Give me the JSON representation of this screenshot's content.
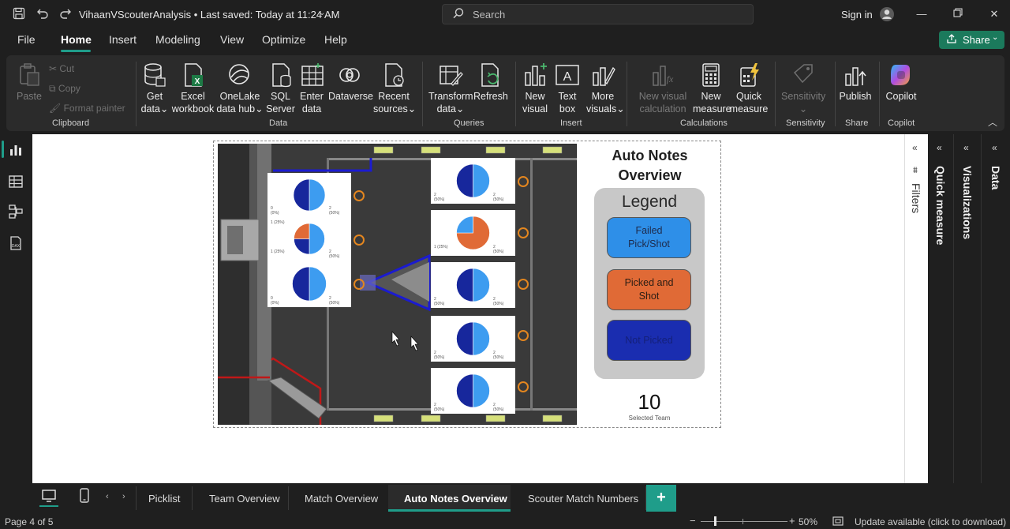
{
  "titlebar": {
    "document_title": "VihaanVScouterAnalysis • Last saved: Today at 11:24 AM",
    "search_placeholder": "Search",
    "sign_in": "Sign in"
  },
  "menu": {
    "items": [
      "File",
      "Home",
      "Insert",
      "Modeling",
      "View",
      "Optimize",
      "Help"
    ],
    "active": "Home",
    "share_label": "Share"
  },
  "ribbon": {
    "clipboard": {
      "paste": "Paste",
      "cut": "Cut",
      "copy": "Copy",
      "format_painter": "Format painter",
      "group": "Clipboard"
    },
    "data": {
      "get_data": [
        "Get",
        "data"
      ],
      "excel": [
        "Excel",
        "workbook"
      ],
      "onelake": [
        "OneLake",
        "data hub"
      ],
      "sql": [
        "SQL",
        "Server"
      ],
      "enter": [
        "Enter",
        "data"
      ],
      "dataverse": "Dataverse",
      "recent": [
        "Recent",
        "sources"
      ],
      "group": "Data"
    },
    "queries": {
      "transform": [
        "Transform",
        "data"
      ],
      "refresh": "Refresh",
      "group": "Queries"
    },
    "insert": {
      "new_visual": [
        "New",
        "visual"
      ],
      "text_box": [
        "Text",
        "box"
      ],
      "more_visuals": [
        "More",
        "visuals"
      ],
      "group": "Insert"
    },
    "calculations": {
      "new_visual_calc": [
        "New visual",
        "calculation"
      ],
      "new_measure": [
        "New",
        "measure"
      ],
      "quick_measure": [
        "Quick",
        "measure"
      ],
      "group": "Calculations"
    },
    "sensitivity": {
      "label": "Sensitivity",
      "group": "Sensitivity"
    },
    "share": {
      "publish": "Publish",
      "group": "Share"
    },
    "copilot": {
      "label": "Copilot",
      "group": "Copilot"
    }
  },
  "report": {
    "title": [
      "Auto Notes",
      "Overview"
    ],
    "legend_title": "Legend",
    "legend_items": [
      {
        "label": [
          "Failed",
          "Pick/Shot"
        ],
        "color": "#2e8fe8",
        "text_color": "#1e2a4a"
      },
      {
        "label": [
          "Picked and",
          "Shot"
        ],
        "color": "#e06a36",
        "text_color": "#2a1d14"
      },
      {
        "label": [
          "Not Picked"
        ],
        "color": "#1a2db0",
        "text_color": "#14207a"
      }
    ],
    "team_number": "10",
    "team_caption": "Selected Team",
    "pie_colors": {
      "light": "#3d9cf0",
      "dark": "#17279c",
      "orange": "#e06a36"
    },
    "pies": [
      {
        "labels": [
          "0\n(0%)",
          "2\n(50%)"
        ],
        "variant": "half"
      },
      {
        "labels": [
          "1 (25%)",
          "1 (25%)",
          "2\n(50%)"
        ],
        "variant": "three"
      },
      {
        "labels": [
          "0\n(0%)",
          "2\n(50%)"
        ],
        "variant": "half"
      },
      {
        "labels": [
          "2\n(50%)",
          "2\n(50%)"
        ],
        "variant": "half"
      },
      {
        "labels": [
          "1 (25%)",
          "2\n(50%)"
        ],
        "variant": "orange"
      },
      {
        "labels": [
          "2\n(50%)",
          "2\n(50%)"
        ],
        "variant": "half"
      },
      {
        "labels": [
          "2\n(50%)",
          "2\n(50%)"
        ],
        "variant": "half"
      },
      {
        "labels": [
          "2\n(50%)",
          "2\n(50%)"
        ],
        "variant": "half"
      }
    ]
  },
  "side_panels": {
    "filters": "Filters",
    "quick_measure": "Quick measure",
    "visualizations": "Visualizations",
    "data": "Data"
  },
  "tabs": {
    "pages": [
      "Picklist",
      "Team Overview",
      "Match Overview",
      "Auto Notes Overview",
      "Scouter Match Numbers"
    ],
    "active": "Auto Notes Overview",
    "add": "+"
  },
  "status": {
    "page_info": "Page 4 of 5",
    "zoom": "50%",
    "update": "Update available (click to download)"
  }
}
